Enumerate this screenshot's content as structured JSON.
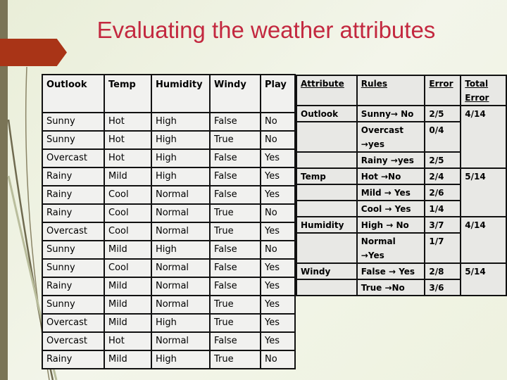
{
  "title": "Evaluating the weather attributes",
  "colors": {
    "title": "#c3283f",
    "accent": "#a93417",
    "sidebar": "#7a7456"
  },
  "data_table": {
    "headers": [
      "Outlook",
      "Temp",
      "Humidity",
      "Windy",
      "Play"
    ],
    "rows": [
      [
        "Sunny",
        "Hot",
        "High",
        "False",
        "No"
      ],
      [
        "Sunny",
        "Hot",
        "High",
        "True",
        "No"
      ],
      [
        "Overcast",
        "Hot",
        "High",
        "False",
        "Yes"
      ],
      [
        "Rainy",
        "Mild",
        "High",
        "False",
        "Yes"
      ],
      [
        "Rainy",
        "Cool",
        "Normal",
        "False",
        "Yes"
      ],
      [
        "Rainy",
        "Cool",
        "Normal",
        "True",
        "No"
      ],
      [
        "Overcast",
        "Cool",
        "Normal",
        "True",
        "Yes"
      ],
      [
        "Sunny",
        "Mild",
        "High",
        "False",
        "No"
      ],
      [
        "Sunny",
        "Cool",
        "Normal",
        "False",
        "Yes"
      ],
      [
        "Rainy",
        "Mild",
        "Normal",
        "False",
        "Yes"
      ],
      [
        "Sunny",
        "Mild",
        "Normal",
        "True",
        "Yes"
      ],
      [
        "Overcast",
        "Mild",
        "High",
        "True",
        "Yes"
      ],
      [
        "Overcast",
        "Hot",
        "Normal",
        "False",
        "Yes"
      ],
      [
        "Rainy",
        "Mild",
        "High",
        "True",
        "No"
      ]
    ]
  },
  "rules_table": {
    "headers": [
      "Attribute",
      "Rules",
      "Error",
      "Total Error"
    ],
    "groups": [
      {
        "attribute": "Outlook",
        "total": "4/14",
        "rules": [
          {
            "rule": "Sunny→ No",
            "error": "2/5"
          },
          {
            "rule": "Overcast →yes",
            "error": "0/4"
          },
          {
            "rule": "Rainy →yes",
            "error": "2/5"
          }
        ]
      },
      {
        "attribute": "Temp",
        "total": "5/14",
        "rules": [
          {
            "rule": "Hot →No",
            "error": "2/4"
          },
          {
            "rule": "Mild → Yes",
            "error": "2/6"
          },
          {
            "rule": "Cool → Yes",
            "error": "1/4"
          }
        ]
      },
      {
        "attribute": "Humidity",
        "total": "4/14",
        "rules": [
          {
            "rule": "High →  No",
            "error": "3/7"
          },
          {
            "rule": "Normal →Yes",
            "error": "1/7"
          }
        ]
      },
      {
        "attribute": "Windy",
        "total": "5/14",
        "rules": [
          {
            "rule": "False → Yes",
            "error": "2/8"
          },
          {
            "rule": "True →No",
            "error": "3/6"
          }
        ]
      }
    ]
  }
}
